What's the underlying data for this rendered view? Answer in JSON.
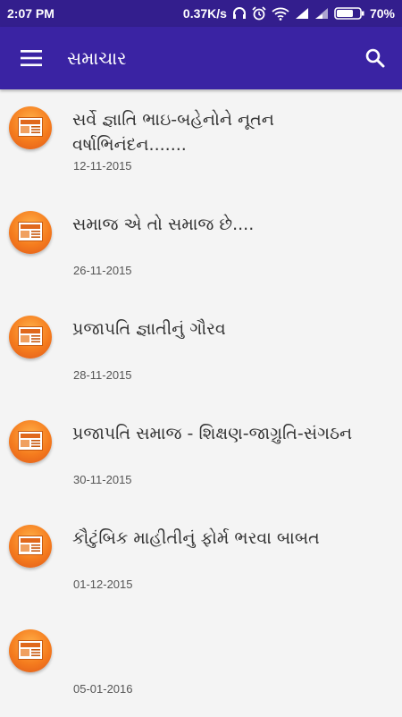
{
  "status_bar": {
    "time": "2:07 PM",
    "network_speed": "0.37K/s",
    "battery": "70%",
    "icons": [
      "headphones-icon",
      "alarm-icon",
      "wifi-icon",
      "signal-icon",
      "signal-icon",
      "battery-icon"
    ]
  },
  "app_bar": {
    "title": "સમાચાર",
    "menu_icon": "menu-icon",
    "search_icon": "search-icon",
    "color": "#3a23a3"
  },
  "news": [
    {
      "title": "સર્વે જ્ઞાતિ ભાઇ-બહેનોને નૂતન વર્ષાભિનંદન.......",
      "date": "12-11-2015"
    },
    {
      "title": "સમાજ એ તો સમાજ છે....",
      "date": "26-11-2015"
    },
    {
      "title": "પ્રજાપતિ જ્ઞાતીનું ગૌરવ",
      "date": "28-11-2015"
    },
    {
      "title": "પ્રજાપતિ સમાજ - શિક્ષણ-જાગ્રુતિ-સંગઠન",
      "date": "30-11-2015"
    },
    {
      "title": "કૌટુંબિક માહીતીનું ફોર્મ ભરવા બાબત",
      "date": "01-12-2015"
    },
    {
      "title": "",
      "date": "05-01-2016"
    }
  ]
}
